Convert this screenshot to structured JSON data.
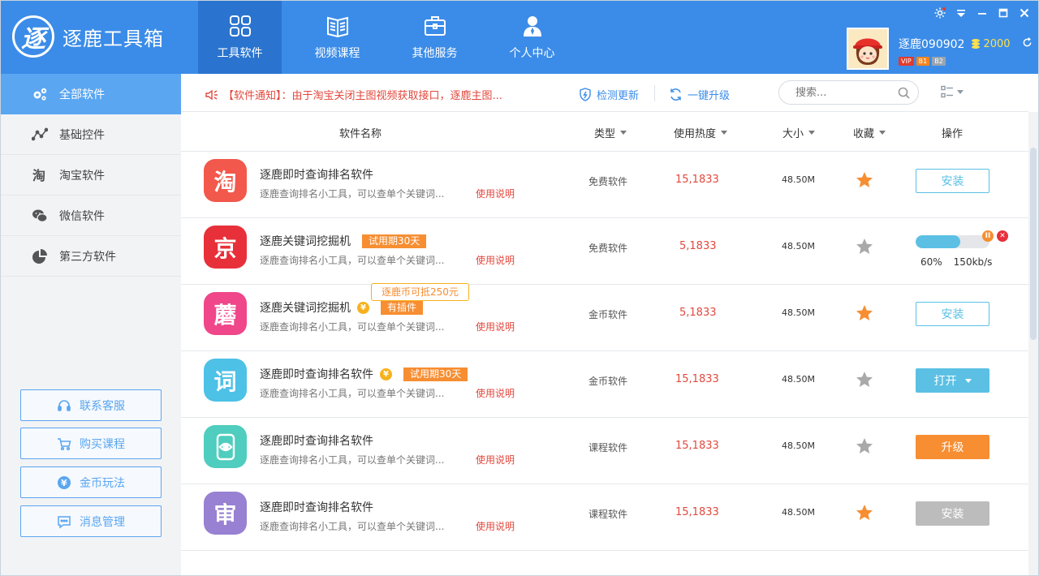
{
  "brand": {
    "logo_char": "逐",
    "name": "逐鹿工具箱"
  },
  "nav": [
    {
      "label": "工具软件",
      "icon": "grid-icon",
      "active": true
    },
    {
      "label": "视频课程",
      "icon": "book-icon",
      "active": false
    },
    {
      "label": "其他服务",
      "icon": "briefcase-icon",
      "active": false
    },
    {
      "label": "个人中心",
      "icon": "person-icon",
      "active": false
    }
  ],
  "window_controls": [
    "settings-icon",
    "dropdown-icon",
    "minimize-icon",
    "maximize-icon",
    "close-icon"
  ],
  "user": {
    "name": "逐鹿090902",
    "coins": "2000",
    "badges": [
      "VIP",
      "B1",
      "B2"
    ],
    "badge_colors": [
      "#e23b2e",
      "#f5841f",
      "#9aa5b1"
    ]
  },
  "sidebar": {
    "items": [
      {
        "label": "全部软件",
        "icon": "gears-icon",
        "active": true
      },
      {
        "label": "基础控件",
        "icon": "line-chart-icon",
        "active": false
      },
      {
        "label": "淘宝软件",
        "icon": "taobao-icon",
        "active": false
      },
      {
        "label": "微信软件",
        "icon": "wechat-icon",
        "active": false
      },
      {
        "label": "第三方软件",
        "icon": "pie-chart-icon",
        "active": false
      }
    ],
    "buttons": [
      {
        "label": "联系客服",
        "icon": "headset-icon"
      },
      {
        "label": "购买课程",
        "icon": "cart-icon"
      },
      {
        "label": "金币玩法",
        "icon": "yen-coin-icon"
      },
      {
        "label": "消息管理",
        "icon": "message-icon"
      }
    ]
  },
  "toolbar": {
    "notice": "【软件通知】：由于淘宝关闭主图视频获取接口，逐鹿主图...",
    "check_update": "检测更新",
    "one_click_upgrade": "一键升级",
    "search_placeholder": "搜索..."
  },
  "table": {
    "headers": {
      "name": "软件名称",
      "type": "类型",
      "hot": "使用热度",
      "size": "大小",
      "fav": "收藏",
      "op": "操作"
    },
    "usage_label": "使用说明",
    "rows": [
      {
        "icon_char": "淘",
        "icon_color": "#f2584b",
        "name": "逐鹿即时查询排名软件",
        "tag": "",
        "coin": false,
        "desc": "逐鹿查询排名小工具，可以查单个关键词...",
        "type": "免费软件",
        "hot": "15,1833",
        "size": "48.50M",
        "fav": true,
        "op": "安装",
        "op_style": "outline"
      },
      {
        "icon_char": "京",
        "icon_color": "#e8303a",
        "name": "逐鹿关键词挖掘机",
        "tag": "试用期30天",
        "coin": false,
        "desc": "逐鹿查询排名小工具，可以查单个关键词...",
        "type": "免费软件",
        "hot": "5,1833",
        "size": "48.50M",
        "fav": false,
        "op": "",
        "op_style": "progress",
        "progress": 0.6,
        "progress_pct": "60%",
        "speed": "150kb/s"
      },
      {
        "icon_char": "蘑",
        "icon_color": "#f0468a",
        "name": "逐鹿关键词挖掘机",
        "tag": "有插件",
        "coin": true,
        "tooltip": "逐鹿币可抵250元",
        "desc": "逐鹿查询排名小工具，可以查单个关键词...",
        "type": "金币软件",
        "hot": "5,1833",
        "size": "48.50M",
        "fav": true,
        "op": "安装",
        "op_style": "outline"
      },
      {
        "icon_char": "词",
        "icon_color": "#4ec1e6",
        "name": "逐鹿即时查询排名软件",
        "tag": "试用期30天",
        "coin": true,
        "desc": "逐鹿查询排名小工具，可以查单个关键词...",
        "type": "金币软件",
        "hot": "15,1833",
        "size": "48.50M",
        "fav": false,
        "op": "打开",
        "op_style": "blue-dropdown"
      },
      {
        "icon_char": "◉",
        "icon_color": "#4fcdbe",
        "name": "逐鹿即时查询排名软件",
        "tag": "",
        "coin": false,
        "desc": "逐鹿查询排名小工具，可以查单个关键词...",
        "type": "课程软件",
        "hot": "15,1833",
        "size": "48.50M",
        "fav": false,
        "op": "升级",
        "op_style": "orange"
      },
      {
        "icon_char": "审",
        "icon_color": "#9880d2",
        "name": "逐鹿即时查询排名软件",
        "tag": "",
        "coin": false,
        "desc": "逐鹿查询排名小工具，可以查单个关键词...",
        "type": "课程软件",
        "hot": "15,1833",
        "size": "48.50M",
        "fav": true,
        "op": "安装",
        "op_style": "gray"
      }
    ]
  },
  "colors": {
    "primary": "#3b8ce8",
    "nav_active": "#2a74cf",
    "accent": "#f78e32",
    "red": "#e2483d",
    "teal": "#5bc0e4",
    "star_on": "#f78e32",
    "star_off": "#a9a9a9"
  }
}
